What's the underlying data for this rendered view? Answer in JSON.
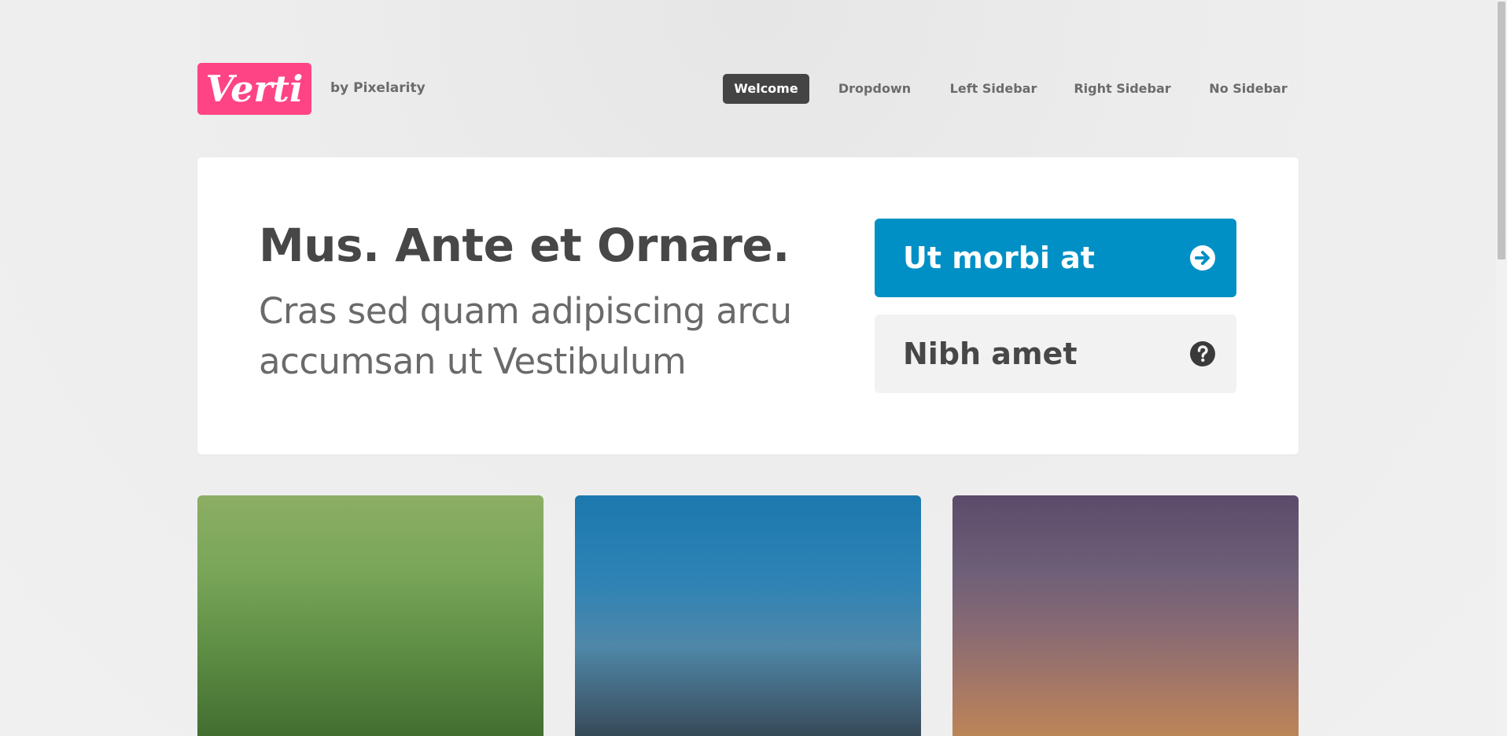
{
  "header": {
    "logo_text": "Verti",
    "byline": "by Pixelarity"
  },
  "nav": {
    "items": [
      {
        "label": "Welcome",
        "active": true
      },
      {
        "label": "Dropdown",
        "active": false
      },
      {
        "label": "Left Sidebar",
        "active": false
      },
      {
        "label": "Right Sidebar",
        "active": false
      },
      {
        "label": "No Sidebar",
        "active": false
      }
    ]
  },
  "banner": {
    "heading": "Mus. Ante et Ornare.",
    "subheading": "Cras sed quam adipiscing arcu accumsan ut Vestibulum",
    "primary_button": {
      "label": "Ut morbi at",
      "icon": "arrow-right-circle-icon"
    },
    "secondary_button": {
      "label": "Nibh amet",
      "icon": "question-circle-icon"
    }
  },
  "colors": {
    "logo": "#ff4486",
    "primary_button": "#0090c5",
    "nav_active": "#444444"
  }
}
